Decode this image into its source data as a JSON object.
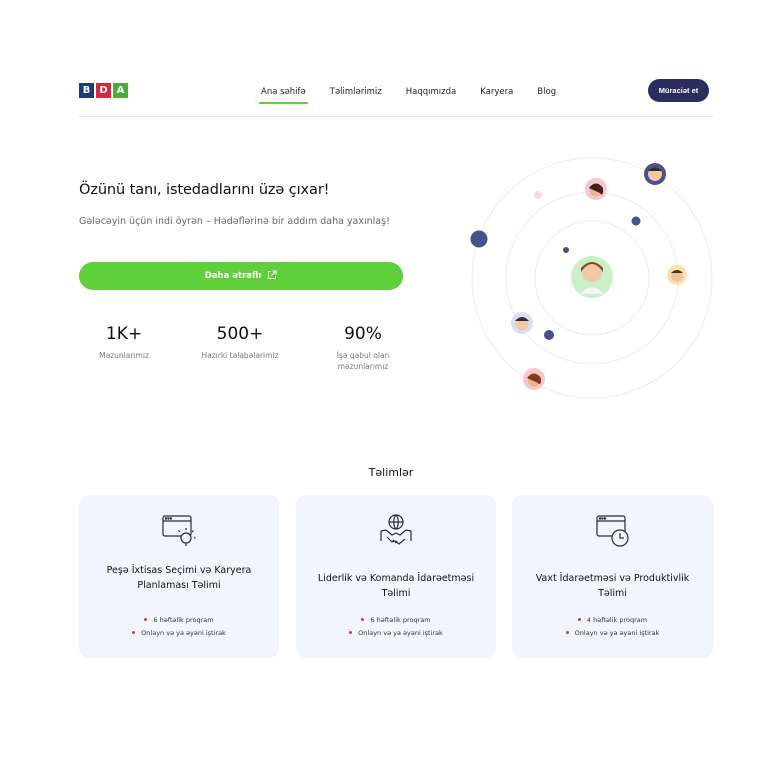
{
  "header": {
    "logo_letters": [
      {
        "char": "B",
        "color": "#1f3a7a"
      },
      {
        "char": "D",
        "color": "#d8263b"
      },
      {
        "char": "A",
        "color": "#4aae3f"
      }
    ],
    "nav": [
      {
        "label": "Ana səhifə",
        "active": true
      },
      {
        "label": "Təlimlərimiz",
        "active": false
      },
      {
        "label": "Haqqımızda",
        "active": false
      },
      {
        "label": "Karyera",
        "active": false
      },
      {
        "label": "Blog",
        "active": false
      }
    ],
    "apply_label": "Müraciət et"
  },
  "hero": {
    "title": "Özünü tanı, istedadlarını üzə çıxar!",
    "subtitle": "Gələcəyin üçün indi öyrən – Hədəflərinə bir addım daha yaxınlaş!",
    "cta_label": "Daha ətraflı",
    "stats": [
      {
        "value": "1K+",
        "label": "Məzunlarımız"
      },
      {
        "value": "500+",
        "label": "Hazırki tələbələrimiz"
      },
      {
        "value": "90%",
        "label": "İşə qəbul olan məzunlarımız"
      }
    ]
  },
  "trainings": {
    "title": "Təlimlər",
    "cards": [
      {
        "icon": "browser-lightbulb-icon",
        "title": "Peşə İxtisas Seçimi və Karyera Planlaması Təlimi",
        "bullets": [
          "6 həftəlik proqram",
          "Onlayn və ya əyani iştirak"
        ]
      },
      {
        "icon": "handshake-globe-icon",
        "title": "Liderlik və Komanda İdarəetməsi Təlimi",
        "bullets": [
          "6 həftəlik proqram",
          "Onlayn və ya əyani iştirak"
        ]
      },
      {
        "icon": "browser-clock-icon",
        "title": "Vaxt İdarəetməsi və Produktivlik Təlimi",
        "bullets": [
          "4 həftəlik proqram",
          "Onlayn və ya əyani iştirak"
        ]
      }
    ]
  },
  "colors": {
    "accent_green": "#5fcf3b",
    "navy": "#2b2d5e",
    "card_bg": "#f2f5fd",
    "bullet_red": "#e0383e"
  }
}
